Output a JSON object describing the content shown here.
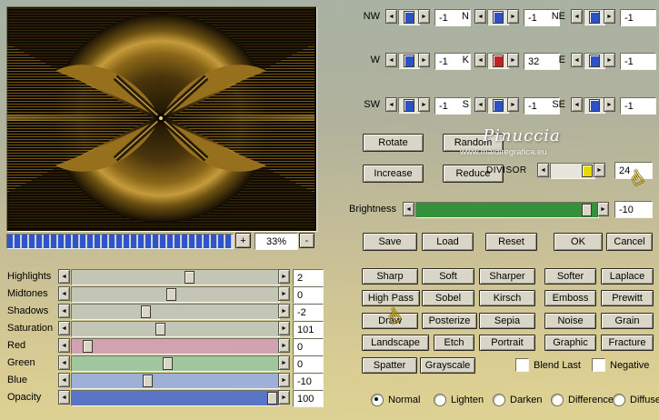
{
  "icons": {
    "left_arrow": "◄",
    "right_arrow": "►",
    "plus": "+",
    "minus": "-",
    "hand": "☝"
  },
  "zoom": {
    "percent": "33%"
  },
  "spinners": {
    "nw": {
      "label": "NW",
      "value": "-1"
    },
    "n": {
      "label": "N",
      "value": "-1"
    },
    "ne": {
      "label": "NE",
      "value": "-1"
    },
    "w": {
      "label": "W",
      "value": "-1"
    },
    "k": {
      "label": "K",
      "value": "32"
    },
    "e": {
      "label": "E",
      "value": "-1"
    },
    "sw": {
      "label": "SW",
      "value": "-1"
    },
    "s": {
      "label": "S",
      "value": "-1"
    },
    "se": {
      "label": "SE",
      "value": "-1"
    }
  },
  "actions": {
    "rotate": "Rotate",
    "random": "Random",
    "increase": "Increase",
    "reduce": "Reduce"
  },
  "divisor": {
    "label": "DIVISOR",
    "value": "24"
  },
  "brightness": {
    "label": "Brightness",
    "value": "-10"
  },
  "dialog": {
    "save": "Save",
    "load": "Load",
    "reset": "Reset",
    "ok": "OK",
    "cancel": "Cancel"
  },
  "filters": {
    "sharp": "Sharp",
    "soft": "Soft",
    "sharper": "Sharper",
    "softer": "Softer",
    "laplace": "Laplace",
    "high_pass": "High Pass",
    "sobel": "Sobel",
    "kirsch": "Kirsch",
    "emboss": "Emboss",
    "prewitt": "Prewitt",
    "draw": "Draw",
    "posterize": "Posterize",
    "sepia": "Sepia",
    "noise": "Noise",
    "grain": "Grain",
    "landscape": "Landscape",
    "etch": "Etch",
    "portrait": "Portrait",
    "graphic": "Graphic",
    "fracture": "Fracture",
    "spatter": "Spatter",
    "grayscale": "Grayscale"
  },
  "toggles": {
    "blend_last": "Blend Last",
    "negative": "Negative",
    "blend_last_checked": false,
    "negative_checked": false
  },
  "modes": {
    "normal": "Normal",
    "lighten": "Lighten",
    "darken": "Darken",
    "difference": "Difference",
    "diffuse": "Diffuse"
  },
  "modes_selected": "normal",
  "adjust": {
    "highlights": {
      "label": "Highlights",
      "value": "2"
    },
    "midtones": {
      "label": "Midtones",
      "value": "0"
    },
    "shadows": {
      "label": "Shadows",
      "value": "-2"
    },
    "saturation": {
      "label": "Saturation",
      "value": "101"
    },
    "red": {
      "label": "Red",
      "value": "0"
    },
    "green": {
      "label": "Green",
      "value": "0"
    },
    "blue": {
      "label": "Blue",
      "value": "-10"
    },
    "opacity": {
      "label": "Opacity",
      "value": "100"
    }
  },
  "watermark": {
    "title": "Pinuccia",
    "url": "www.maidiregrafica.eu"
  },
  "colors": {
    "spinner_thumb_blue": "#2b50c8",
    "spinner_thumb_red": "#c42222",
    "divisor_thumb_yellow": "#e6da00",
    "track_red": "#d2a2b2",
    "track_green": "#9fc69e",
    "track_blue": "#9fb0d6",
    "track_opacity": "#5a74c6",
    "track_brightness": "#35913c",
    "zoom_segment_blue": "#2f55cc"
  }
}
